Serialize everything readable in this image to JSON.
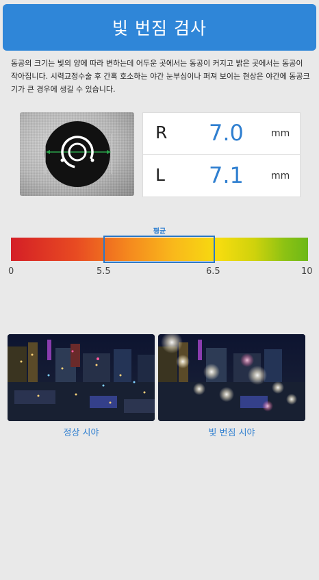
{
  "header": {
    "title": "빛 번짐 검사"
  },
  "description": "동공의 크기는 빛의 양에 따라 변하는데 어두운 곳에서는 동공이 커지고 밝은 곳에서는 동공이 작아집니다. 시력교정수술 후 간혹 호소하는 야간 눈부심이나 퍼져 보이는 현상은 야간에 동공크기가 큰 경우에 생길 수 있습니다.",
  "measurements": {
    "right": {
      "eye": "R",
      "value": "7.0",
      "unit": "mm"
    },
    "left": {
      "eye": "L",
      "value": "7.1",
      "unit": "mm"
    }
  },
  "scale": {
    "average_label": "평균",
    "ticks": [
      "0",
      "5.5",
      "6.5",
      "10"
    ],
    "min": 0,
    "max": 10,
    "average_range": [
      5.5,
      6.5
    ],
    "gradient_colors": [
      "#d41f26",
      "#f58a1e",
      "#f6dc0f",
      "#6cb817"
    ]
  },
  "comparison": {
    "normal_caption": "정상 시야",
    "glare_caption": "빛 번짐 시야"
  },
  "icons": {
    "pupil": "pupil-measure-icon"
  }
}
